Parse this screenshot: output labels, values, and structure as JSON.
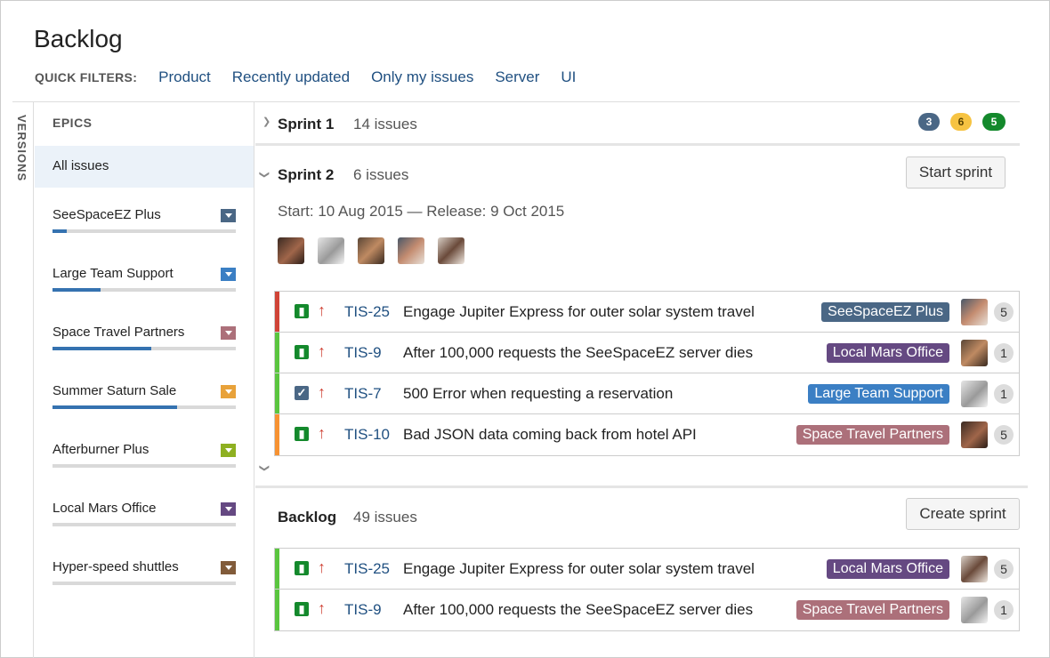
{
  "page": {
    "title": "Backlog"
  },
  "quick_filters": {
    "label": "QUICK FILTERS:",
    "items": [
      "Product",
      "Recently updated",
      "Only my issues",
      "Server",
      "UI"
    ]
  },
  "versions_tab": {
    "label": "VERSIONS"
  },
  "epics": {
    "title": "EPICS",
    "all_label": "All issues",
    "items": [
      {
        "name": "SeeSpaceEZ Plus",
        "color": "#4a6785",
        "progress": 0.08
      },
      {
        "name": "Large Team Support",
        "color": "#3b7fc4",
        "progress": 0.26
      },
      {
        "name": "Space Travel Partners",
        "color": "#ac707a",
        "progress": 0.54
      },
      {
        "name": "Summer Saturn Sale",
        "color": "#e8a23a",
        "progress": 0.68
      },
      {
        "name": "Afterburner Plus",
        "color": "#8eb021",
        "progress": 0
      },
      {
        "name": "Local Mars Office",
        "color": "#654982",
        "progress": 0
      },
      {
        "name": "Hyper-speed shuttles",
        "color": "#815b3a",
        "progress": 0
      }
    ]
  },
  "sprint1": {
    "name": "Sprint 1",
    "count": "14 issues",
    "badges": [
      {
        "value": "3",
        "color": "#4a6785",
        "text_color": "#ffffff"
      },
      {
        "value": "6",
        "color": "#f6c342",
        "text_color": "#594300"
      },
      {
        "value": "5",
        "color": "#14892c",
        "text_color": "#ffffff"
      }
    ]
  },
  "sprint2": {
    "name": "Sprint 2",
    "count": "6 issues",
    "button": "Start sprint",
    "dates": "Start: 10 Aug 2015  —  Release: 9 Oct 2015",
    "avatars": [
      "avatar-1",
      "avatar-2",
      "avatar-3",
      "avatar-4",
      "avatar-5"
    ],
    "issues": [
      {
        "stripe": "#d04437",
        "type": "story",
        "priority": "↑",
        "key": "TIS-25",
        "summary": "Engage Jupiter Express for outer solar system travel",
        "epic": "SeeSpaceEZ Plus",
        "epic_color": "#4a6785",
        "points": "5"
      },
      {
        "stripe": "#5ac53f",
        "type": "story",
        "priority": "↑",
        "key": "TIS-9",
        "summary": "After 100,000 requests the SeeSpaceEZ server dies",
        "epic": "Local Mars Office",
        "epic_color": "#654982",
        "points": "1"
      },
      {
        "stripe": "#5ac53f",
        "type": "task",
        "priority": "↑",
        "key": "TIS-7",
        "summary": "500 Error when requesting a reservation",
        "epic": "Large Team Support",
        "epic_color": "#3b7fc4",
        "points": "1"
      },
      {
        "stripe": "#f79232",
        "type": "story",
        "priority": "↑",
        "key": "TIS-10",
        "summary": "Bad JSON data coming back from hotel API",
        "epic": "Space Travel Partners",
        "epic_color": "#ac707a",
        "points": "5"
      }
    ]
  },
  "backlog": {
    "name": "Backlog",
    "count": "49 issues",
    "button": "Create sprint",
    "issues": [
      {
        "stripe": "#5ac53f",
        "type": "story",
        "priority": "↑",
        "key": "TIS-25",
        "summary": "Engage Jupiter Express for outer solar system travel",
        "epic": "Local Mars Office",
        "epic_color": "#654982",
        "points": "5"
      },
      {
        "stripe": "#5ac53f",
        "type": "story",
        "priority": "↑",
        "key": "TIS-9",
        "summary": "After 100,000 requests the SeeSpaceEZ server dies",
        "epic": "Space Travel Partners",
        "epic_color": "#ac707a",
        "points": "1"
      }
    ]
  }
}
